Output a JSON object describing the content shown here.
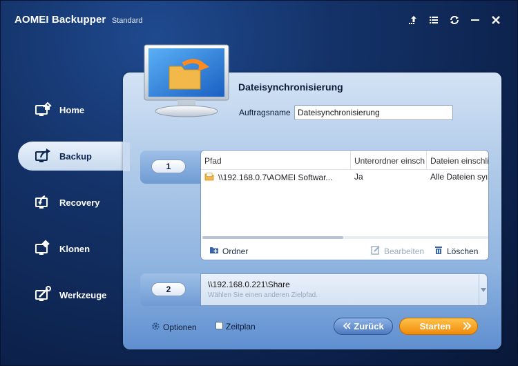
{
  "window": {
    "app_name": "AOMEI Backupper",
    "edition": "Standard"
  },
  "controls": {
    "icons": [
      "upgrade-icon",
      "menu-icon",
      "refresh-icon",
      "minimize-icon",
      "close-icon"
    ]
  },
  "nav": {
    "items": [
      {
        "label": "Home",
        "icon": "home-icon"
      },
      {
        "label": "Backup",
        "icon": "backup-icon",
        "active": true
      },
      {
        "label": "Recovery",
        "icon": "recovery-icon"
      },
      {
        "label": "Klonen",
        "icon": "clone-icon"
      },
      {
        "label": "Werkzeuge",
        "icon": "tools-icon"
      }
    ]
  },
  "main": {
    "title": "Dateisynchronisierung",
    "job_label": "Auftragsname",
    "job_value": "Dateisynchronisierung",
    "step1": {
      "number": "1",
      "columns": [
        "Pfad",
        "Unterordner einsch",
        "Dateien einschli"
      ],
      "rows": [
        {
          "path": "\\\\192.168.0.7\\AOMEI Softwar...",
          "subfolders": "Ja",
          "files": "Alle Dateien syı"
        }
      ],
      "add_folder": "Ordner",
      "edit": "Bearbeiten",
      "delete": "Löschen"
    },
    "step2": {
      "number": "2",
      "path": "\\\\192.168.0.221\\Share",
      "hint": "Wählen Sie einen anderen Zielpfad."
    },
    "options_label": "Optionen",
    "schedule_label": "Zeitplan",
    "back_label": "Zurück",
    "start_label": "Starten"
  },
  "colors": {
    "accent_orange": "#f08b0a",
    "back_blue": "#4d79bf",
    "panel_blue": "#b4cdea"
  }
}
